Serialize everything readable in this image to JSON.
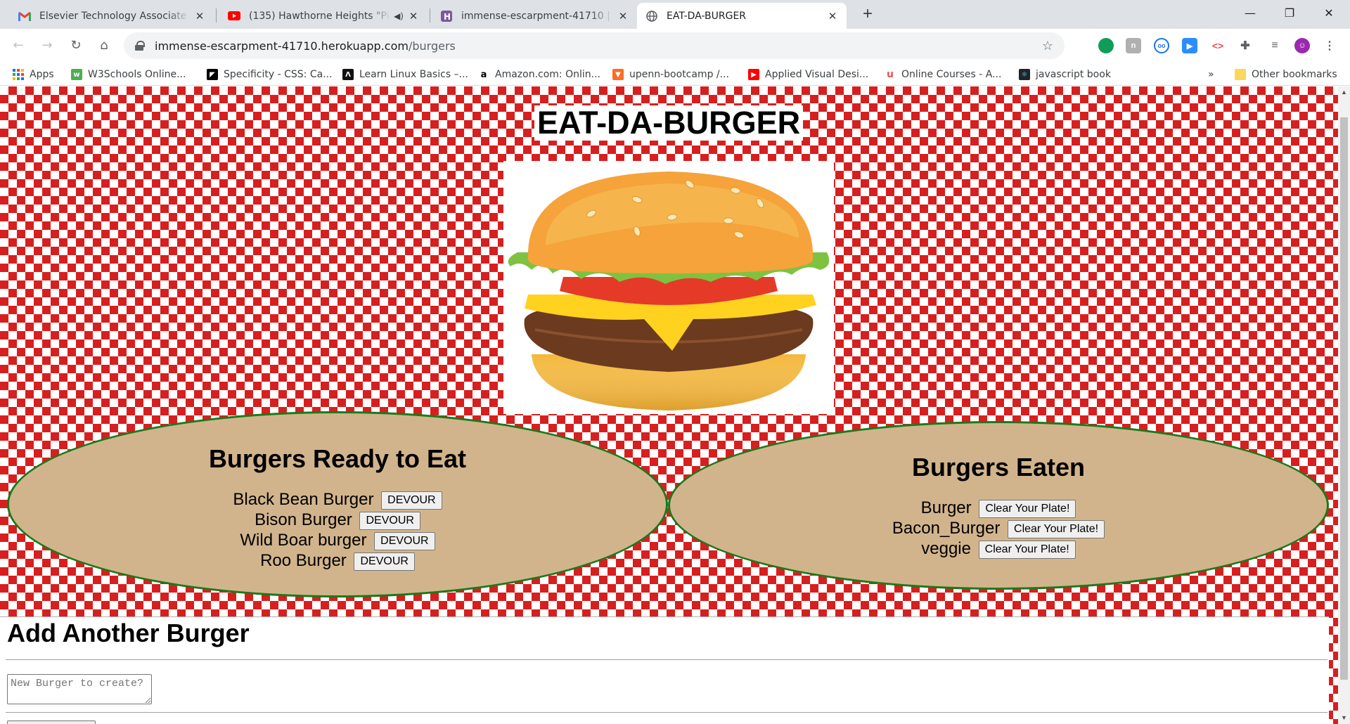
{
  "browser": {
    "tabs": [
      {
        "title": "Elsevier Technology Associate Pro",
        "icon": "gmail-icon",
        "active": false
      },
      {
        "title": "(135) Hawthorne Heights \"Pi",
        "icon": "youtube-icon",
        "active": false,
        "audio": true
      },
      {
        "title": "immense-escarpment-41710 | He",
        "icon": "heroku-icon",
        "active": false
      },
      {
        "title": "EAT-DA-BURGER",
        "icon": "globe-icon",
        "active": true
      }
    ],
    "url_host": "immense-escarpment-41710.herokuapp.com",
    "url_path": "/burgers",
    "bookmarks": [
      {
        "label": "Apps",
        "icon": "apps-grid-icon"
      },
      {
        "label": "W3Schools Online...",
        "icon": "w3schools-icon"
      },
      {
        "label": "Specificity - CSS: Ca...",
        "icon": "mdn-icon"
      },
      {
        "label": "Learn Linux Basics –...",
        "icon": "linux-icon"
      },
      {
        "label": "Amazon.com: Onlin...",
        "icon": "amazon-icon"
      },
      {
        "label": "upenn-bootcamp /...",
        "icon": "gitlab-icon"
      },
      {
        "label": "Applied Visual Desi...",
        "icon": "youtube-icon"
      },
      {
        "label": "Online Courses - A...",
        "icon": "udemy-icon"
      },
      {
        "label": "javascript book",
        "icon": "react-icon"
      }
    ],
    "bookmarks_overflow": "»",
    "other_bookmarks": "Other bookmarks"
  },
  "page": {
    "title": "EAT-DA-BURGER",
    "ready": {
      "heading": "Burgers Ready to Eat",
      "button_label": "DEVOUR",
      "items": [
        "Black Bean Burger",
        "Bison Burger",
        "Wild Boar burger",
        "Roo Burger"
      ]
    },
    "eaten": {
      "heading": "Burgers Eaten",
      "button_label": "Clear Your Plate!",
      "items": [
        "Burger",
        "Bacon_Burger",
        "veggie"
      ]
    },
    "add": {
      "heading": "Add Another Burger",
      "placeholder": "New Burger to create?"
    }
  }
}
